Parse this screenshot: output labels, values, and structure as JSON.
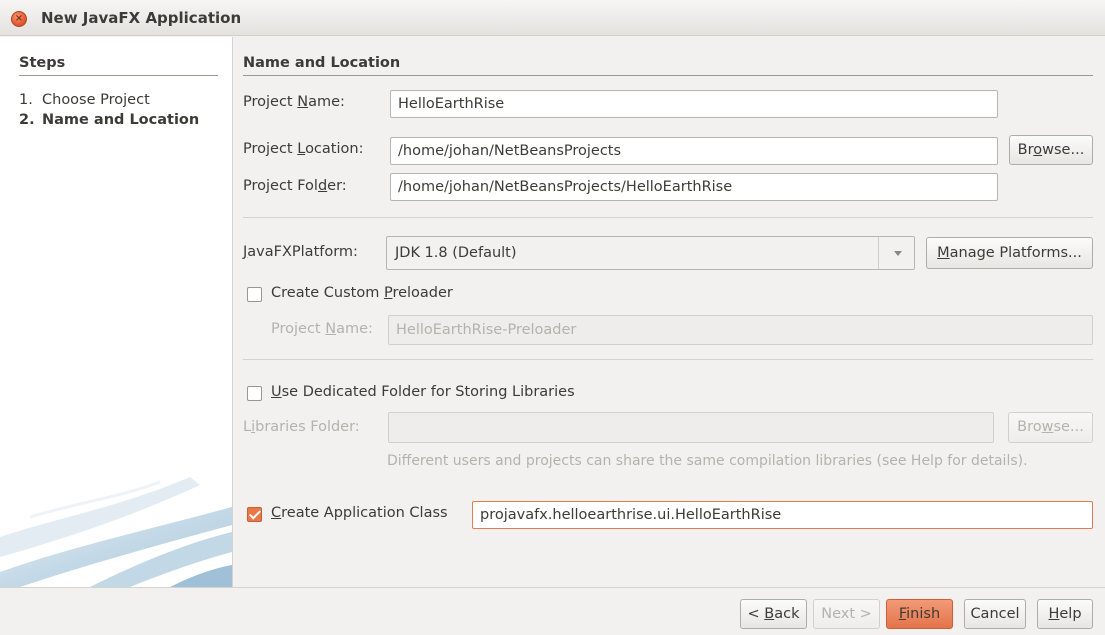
{
  "window": {
    "title": "New JavaFX Application"
  },
  "steps": {
    "heading": "Steps",
    "items": [
      {
        "num": "1.",
        "label": "Choose Project"
      },
      {
        "num": "2.",
        "label": "Name and Location"
      }
    ]
  },
  "main": {
    "heading": "Name and Location",
    "project_name": {
      "label_pre": "Project ",
      "label_key": "N",
      "label_post": "ame:",
      "value": "HelloEarthRise"
    },
    "project_location": {
      "label_pre": "Project ",
      "label_key": "L",
      "label_post": "ocation:",
      "value": "/home/johan/NetBeansProjects",
      "browse_pre": "Br",
      "browse_key": "o",
      "browse_post": "wse..."
    },
    "project_folder": {
      "label_pre": "Project Fol",
      "label_key": "d",
      "label_post": "er:",
      "value": "/home/johan/NetBeansProjects/HelloEarthRise"
    },
    "platform": {
      "label_pre": "",
      "label_key": "J",
      "label_post": "avaFXPlatform:",
      "value": "JDK 1.8 (Default)",
      "manage_pre": "",
      "manage_key": "M",
      "manage_post": "anage Platforms..."
    },
    "preloader": {
      "checkbox_pre": "Create Custom ",
      "checkbox_key": "P",
      "checkbox_post": "reloader",
      "checked": false,
      "name_pre": "Project ",
      "name_key": "N",
      "name_post": "ame:",
      "name_value": "HelloEarthRise-Preloader"
    },
    "libraries": {
      "checkbox_pre": "",
      "checkbox_key": "U",
      "checkbox_post": "se Dedicated Folder for Storing Libraries",
      "checked": false,
      "folder_pre": "L",
      "folder_key": "i",
      "folder_post": "braries Folder:",
      "folder_value": "",
      "browse_pre": "Bro",
      "browse_key": "w",
      "browse_post": "se...",
      "hint": "Different users and projects can share the same compilation libraries (see Help for details)."
    },
    "app_class": {
      "checkbox_pre": "",
      "checkbox_key": "C",
      "checkbox_post": "reate Application Class",
      "checked": true,
      "value": "projavafx.helloearthrise.ui.HelloEarthRise"
    }
  },
  "buttons": {
    "back": {
      "pre": "< ",
      "key": "B",
      "post": "ack"
    },
    "next": {
      "pre": "Next >",
      "key": "",
      "post": ""
    },
    "finish": {
      "pre": "",
      "key": "F",
      "post": "inish"
    },
    "cancel": {
      "pre": "Cancel",
      "key": "",
      "post": ""
    },
    "help": {
      "pre": "",
      "key": "H",
      "post": "elp"
    }
  },
  "colors": {
    "accent": "#e4744a",
    "panel": "#f2f1f0",
    "text": "#3c3b37",
    "disabled_text": "#b5b2ad"
  },
  "icons": [
    "close-icon",
    "dropdown-arrow-icon",
    "checkmark-icon"
  ]
}
